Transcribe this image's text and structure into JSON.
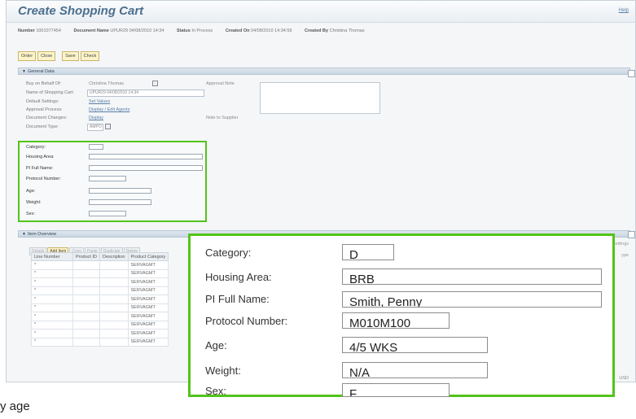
{
  "title": "Create Shopping Cart",
  "help_link": "Help",
  "meta": [
    {
      "label": "Number",
      "value": "1001077454"
    },
    {
      "label": "Document Name",
      "value": "UPUR29 04/08/2010 14:34"
    },
    {
      "label": "Status",
      "value": "In Process"
    },
    {
      "label": "Created On",
      "value": "04/08/2010 14:34:59"
    },
    {
      "label": "Created By",
      "value": "Christina Thomas"
    }
  ],
  "toolbar": {
    "order": "Order",
    "close": "Close",
    "save": "Save",
    "check": "Check"
  },
  "general": {
    "section_title": "General Data",
    "rows": [
      {
        "label": "Buy on Behalf Of:",
        "value": "Christina Thomas"
      },
      {
        "label": "Name of Shopping Cart:",
        "value": "UPUR29 04/08/2010 14:34"
      },
      {
        "label": "Default Settings:",
        "value": "Set Values"
      },
      {
        "label": "Approval Process:",
        "value": "Display / Edit Agents"
      },
      {
        "label": "Document Changes:",
        "value": "Display"
      },
      {
        "label": "Document Type:",
        "value": "AMPO"
      }
    ],
    "approval_note": "Approval Note",
    "note_supplier": "Note to Supplier"
  },
  "custom_fields": [
    "Category:",
    "Housing Area:",
    "PI Full Name:",
    "Protocol Number:",
    "Age:",
    "Weight:",
    "Sex:"
  ],
  "item_overview": {
    "section_title": "Item Overview",
    "buttons": [
      "Details",
      "Add Item",
      "Copy",
      "Paste",
      "Duplicate",
      "Delete"
    ],
    "columns": [
      "Line Number",
      "Product ID",
      "Description",
      "Product Category"
    ],
    "rows": [
      [
        "*",
        "",
        "",
        "SERVAGMT"
      ],
      [
        "*",
        "",
        "",
        "SERVAGMT"
      ],
      [
        "*",
        "",
        "",
        "SERVAGMT"
      ],
      [
        "*",
        "",
        "",
        "SERVAGMT"
      ],
      [
        "*",
        "",
        "",
        "SERVAGMT"
      ],
      [
        "*",
        "",
        "",
        "SERVAGMT"
      ],
      [
        "*",
        "",
        "",
        "SERVAGMT"
      ],
      [
        "*",
        "",
        "",
        "SERVAGMT"
      ],
      [
        "*",
        "",
        "",
        "SERVAGMT"
      ],
      [
        "*",
        "",
        "",
        "SERVAGMT"
      ]
    ],
    "right_settings": "Settings",
    "right_type": "ype",
    "currency": "USD"
  },
  "callout": {
    "fields": [
      {
        "label": "Category:",
        "value": "D"
      },
      {
        "label": "Housing Area:",
        "value": "BRB"
      },
      {
        "label": "PI Full Name:",
        "value": "Smith, Penny"
      },
      {
        "label": "Protocol Number:",
        "value": "M010M100"
      },
      {
        "label": "Age:",
        "value": "4/5 WKS"
      },
      {
        "label": "Weight:",
        "value": "N/A"
      },
      {
        "label": "Sex:",
        "value": "F"
      }
    ]
  },
  "outside_text": "y age",
  "colors": {
    "highlight": "#52c41a",
    "title": "#4b6f8f",
    "button": "#fdf3c8"
  }
}
